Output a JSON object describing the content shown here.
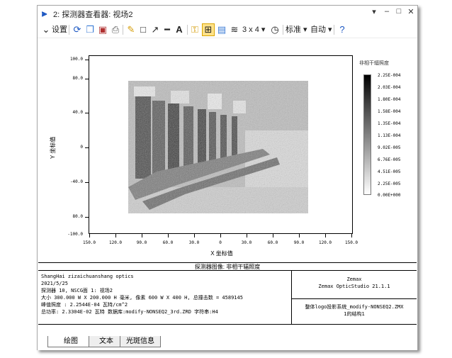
{
  "window": {
    "title": "2: 探测器查看器: 视场2",
    "app_icon": "zemax-logo-icon",
    "controls": [
      "▾",
      "–",
      "□",
      "✕"
    ]
  },
  "toolbar": {
    "settings_label": "设置",
    "layout_label": "3 x 4 ▾",
    "standard_label": "标准 ▾",
    "auto_label": "自动 ▾"
  },
  "plot": {
    "y_ticks": [
      "100.0",
      "80.0",
      "40.0",
      "0",
      "-40.0",
      "80.0",
      "-100.0"
    ],
    "x_ticks": [
      "150.0",
      "120.0",
      "90.0",
      "60.0",
      "30.0",
      "0",
      "30.0",
      "60.0",
      "90.0",
      "120.0",
      "150.0"
    ],
    "x_label": "X 坐标值",
    "y_label": "Y 坐标值",
    "colorbar_title": "非相干辐照度",
    "colorbar_ticks": [
      "2.25E-004",
      "2.03E-004",
      "1.80E-004",
      "1.58E-004",
      "1.35E-004",
      "1.13E-004",
      "9.02E-005",
      "6.76E-005",
      "4.51E-005",
      "2.25E-005",
      "0.00E+000"
    ]
  },
  "info": {
    "title": "探测器图像: 非相干辐照度",
    "left_lines": [
      "ShangHai zizaichuanshang optics",
      "2021/5/25",
      "探测器 10, NSCG面 1: 视场2",
      "大小 300.000 W X 200.000 H 毫米, 像素 600 W X 400 H, 总撞击数 = 4589145",
      "峰值照度 : 2.2544E-04 瓦特/cm^2",
      "总功率: 2.3304E-02 瓦特 数据库:modify-NONSEQ2_3rd.ZRD 字符串:H4"
    ],
    "right_top": [
      "Zemax",
      "Zemax OpticStudio 21.1.1"
    ],
    "right_bottom": [
      "整体logo投影系统_modify-NONSEQ2.ZMX",
      "1的结构1"
    ]
  },
  "tabs": [
    "绘图",
    "文本",
    "光斑信息"
  ],
  "colors": {
    "accent": "#1a56c2",
    "highlight": "#ffe28a"
  }
}
